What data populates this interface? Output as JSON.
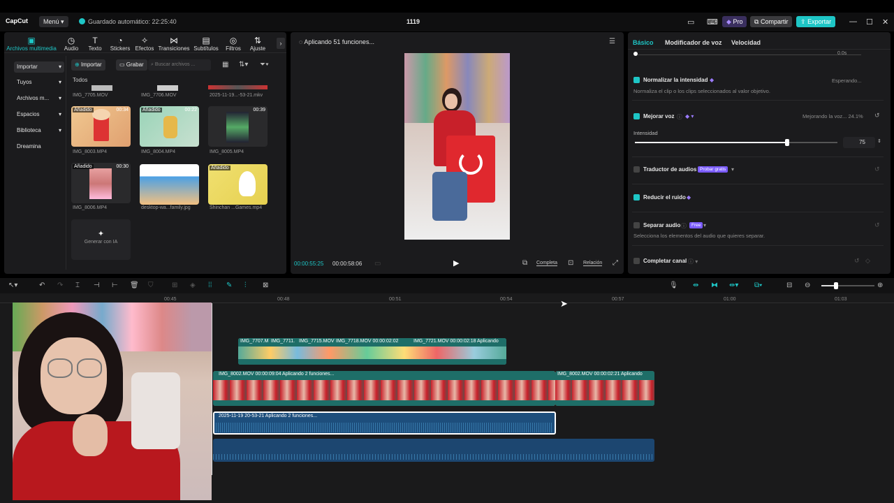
{
  "app": {
    "logo": "CapCut",
    "menu_label": "Menú ▾",
    "autosave": "Guardado automático: 22:25:40",
    "project_title": "1119",
    "pro_label": "Pro",
    "share_label": "Compartir",
    "export_label": "Exportar"
  },
  "toolbar": {
    "items": [
      {
        "label": "Archivos multimedia",
        "icon": "media-icon"
      },
      {
        "label": "Audio",
        "icon": "audio-icon"
      },
      {
        "label": "Texto",
        "icon": "text-icon"
      },
      {
        "label": "Stickers",
        "icon": "sticker-icon"
      },
      {
        "label": "Efectos",
        "icon": "effects-icon"
      },
      {
        "label": "Transiciones",
        "icon": "transition-icon"
      },
      {
        "label": "Subtítulos",
        "icon": "subtitle-icon"
      },
      {
        "label": "Filtros",
        "icon": "filter-icon"
      },
      {
        "label": "Ajuste",
        "icon": "adjust-icon"
      }
    ]
  },
  "sidebar": {
    "items": [
      "Importar",
      "Tuyos",
      "Archivos m...",
      "Espacios",
      "Biblioteca",
      "Dreamina"
    ]
  },
  "media": {
    "import_label": "Importar",
    "record_label": "Grabar",
    "search_placeholder": "Buscar archivos ...",
    "filter_all": "Todos",
    "top_labels": [
      "IMG_7705.MOV",
      "IMG_7706.MOV",
      "2025-11-19...-53-21.mkv"
    ],
    "row1": [
      {
        "name": "IMG_8003.MP4",
        "badge": "Añadido",
        "duration": "00:34"
      },
      {
        "name": "IMG_8004.MP4",
        "badge": "Añadido",
        "duration": "00:22"
      },
      {
        "name": "IMG_8005.MP4",
        "badge": "",
        "duration": "00:39"
      }
    ],
    "row2": [
      {
        "name": "IMG_8006.MP4",
        "badge": "Añadido",
        "duration": "00:30"
      },
      {
        "name": "desktop-wa...family.jpg",
        "badge": "",
        "duration": ""
      },
      {
        "name": "Shinchan ...Games.mp4",
        "badge": "Añadido",
        "duration": ""
      }
    ],
    "generate_label": "Generar con IA"
  },
  "player": {
    "status": "Aplicando 51 funciones...",
    "current_time": "00:00:55:25",
    "total_time": "00:00:58:06",
    "full_label": "Completa",
    "ratio_label": "Relación"
  },
  "properties": {
    "tabs": [
      "Básico",
      "Modificador de voz",
      "Velocidad"
    ],
    "normalize": {
      "title": "Normalizar la intensidad",
      "desc": "Normaliza el clip o los clips seleccionados al valor objetivo.",
      "status": "Esperando..."
    },
    "enhance": {
      "title": "Mejorar voz",
      "status": "Mejorando la voz... 24.1%",
      "intensity_label": "Intensidad",
      "intensity_value": "75",
      "intensity_fraction": 0.75
    },
    "translate": {
      "title": "Traductor de audios",
      "badge": "Probar gratis"
    },
    "noise": {
      "title": "Reducir el ruido"
    },
    "separate": {
      "title": "Separar audio",
      "badge": "Free",
      "desc": "Selecciona los elementos del audio que quieres separar."
    },
    "channel": {
      "title": "Completar canal"
    },
    "top_value": "0.0s"
  },
  "timeline": {
    "ruler": [
      "00:45",
      "00:48",
      "00:51",
      "00:54",
      "00:57",
      "01:00",
      "01:03"
    ],
    "track1_labels": [
      "IMG_7707.M",
      "IMG_7711.",
      "IMG_7715.MOV",
      "IMG_7718.MOV  00:00:02:02",
      "IMG_7721.MOV  00:00:02:18  Aplicando"
    ],
    "track2_a": "IMG_8002.MOV   00:00:09:04   Aplicando 2 funciones...",
    "track2_b": "IMG_8002.MOV   00:00:02:21   Aplicando",
    "audio_label": "2025-11-19 20-53-21    Aplicando 2 funciones..."
  },
  "colors": {
    "accent": "#1ec6c6",
    "clip_video": "#1d6b66",
    "audio": "#1f4f7a",
    "pro": "#7b5cff"
  }
}
